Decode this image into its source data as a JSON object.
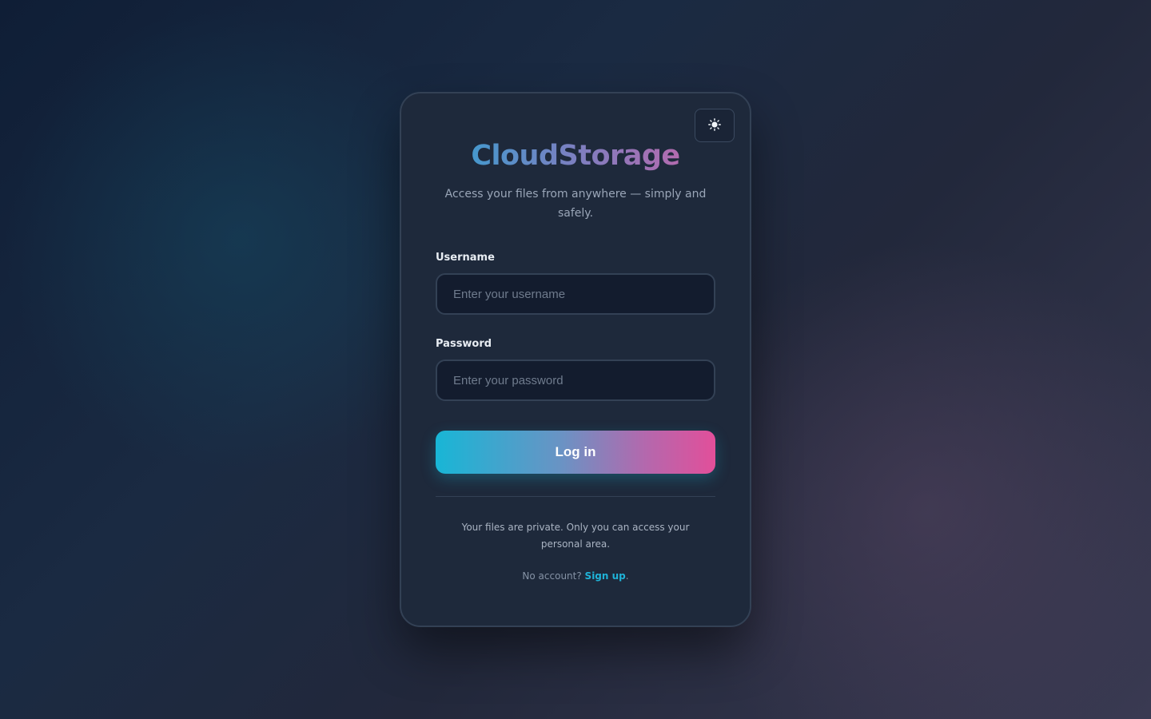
{
  "app": {
    "brand": "CloudStorage",
    "tagline": "Access your files from anywhere — simply and safely."
  },
  "theme_toggle": {
    "icon": "sun-icon"
  },
  "form": {
    "username": {
      "label": "Username",
      "placeholder": "Enter your username",
      "value": ""
    },
    "password": {
      "label": "Password",
      "placeholder": "Enter your password",
      "value": ""
    },
    "submit_label": "Log in"
  },
  "footer": {
    "privacy_note": "Your files are private. Only you can access your personal area.",
    "signup_prompt": "No account?",
    "signup_link": "Sign up",
    "signup_suffix": "."
  },
  "colors": {
    "accent_cyan": "#18b6d6",
    "accent_pink": "#e24f9a",
    "card_background": "#1e293b",
    "link": "#1fb3d8"
  }
}
